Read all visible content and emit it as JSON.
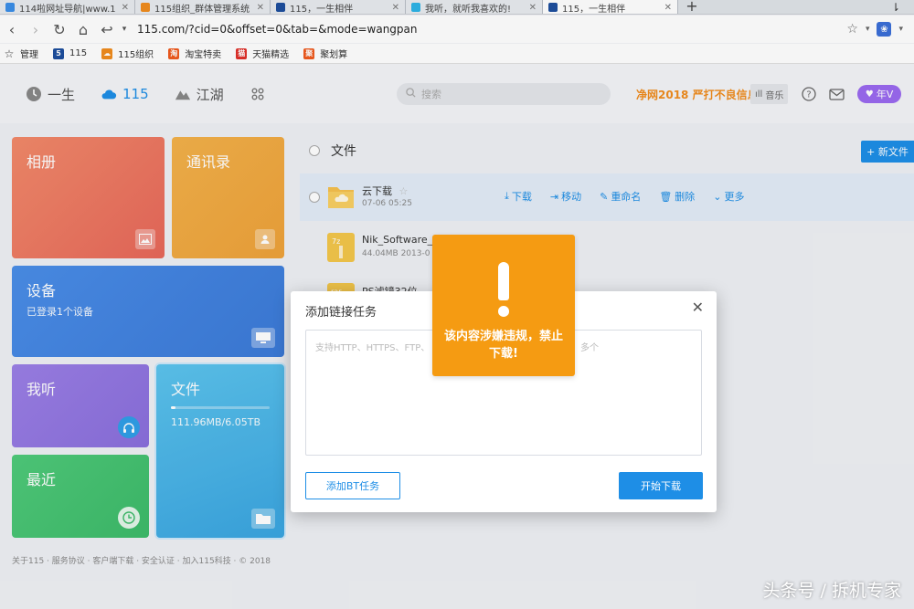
{
  "browser": {
    "tabs": [
      {
        "label": "114啦网址导航|www.1",
        "color": "#3b8ee8",
        "active": false
      },
      {
        "label": "115组织_群体管理系统",
        "color": "#f08c1e",
        "active": false
      },
      {
        "label": "115，一生相伴",
        "color": "#1e4f9e",
        "active": false
      },
      {
        "label": "我听，就听我喜欢的!",
        "color": "#2db4e6",
        "active": false
      },
      {
        "label": "115，一生相伴",
        "color": "#1e4f9e",
        "active": true
      }
    ],
    "url": "115.com/?cid=0&offset=0&tab=&mode=wangpan",
    "bookmarks": [
      {
        "label": "管理",
        "icon": "star-icon",
        "color": "#ffffff"
      },
      {
        "label": "115",
        "icon": "115-logo",
        "color": "#1e4f9e"
      },
      {
        "label": "115组织",
        "icon": "115-org-logo",
        "color": "#f08c1e"
      },
      {
        "label": "淘宝特卖",
        "icon": "taobao-logo",
        "color": "#f05a1e"
      },
      {
        "label": "天猫精选",
        "icon": "tmall-logo",
        "color": "#e0302a"
      },
      {
        "label": "聚划算",
        "icon": "juhuasuan-logo",
        "color": "#f05a1e"
      }
    ]
  },
  "header": {
    "nav": [
      {
        "label": "一生",
        "icon": "clock-icon",
        "active": false
      },
      {
        "label": "115",
        "icon": "cloud-icon",
        "active": true
      },
      {
        "label": "江湖",
        "icon": "mountain-icon",
        "active": false
      }
    ],
    "search_placeholder": "搜索",
    "promo": "净网2018 严打不良信息",
    "music": "音乐",
    "vip": "年V"
  },
  "tiles": {
    "album": "相册",
    "contacts": "通讯录",
    "devices": "设备",
    "devices_sub": "已登录1个设备",
    "listen": "我听",
    "files": "文件",
    "files_usage": "111.96MB/6.05TB",
    "files_usage_fraction": 0.05,
    "recent": "最近"
  },
  "footer": "关于115 · 服务协议 · 客户端下载 · 安全认证 · 加入115科技 · © 2018",
  "files": {
    "header": "文件",
    "new_button": "+ 新文件",
    "rows": [
      {
        "name": "云下载",
        "meta": "07-06 05:25",
        "type": "folder"
      },
      {
        "name": "Nik_Software_E",
        "meta": "44.04MB   2013-0",
        "type": "7z"
      },
      {
        "name": "PS滤镜32位",
        "meta": "",
        "type": "rar"
      }
    ],
    "actions": [
      {
        "label": "下载",
        "icon": "download-icon"
      },
      {
        "label": "移动",
        "icon": "move-icon"
      },
      {
        "label": "重命名",
        "icon": "rename-icon"
      },
      {
        "label": "删除",
        "icon": "trash-icon"
      },
      {
        "label": "更多",
        "icon": "more-icon"
      }
    ]
  },
  "modal": {
    "title": "添加链接任务",
    "placeholder": "支持HTTP、HTTPS、FTP、",
    "placeholder_tail": "多个",
    "bt_button": "添加BT任务",
    "start_button": "开始下载"
  },
  "warning": {
    "message": "该内容涉嫌违规，禁止下载!"
  },
  "watermark": "头条号 / 拆机专家"
}
